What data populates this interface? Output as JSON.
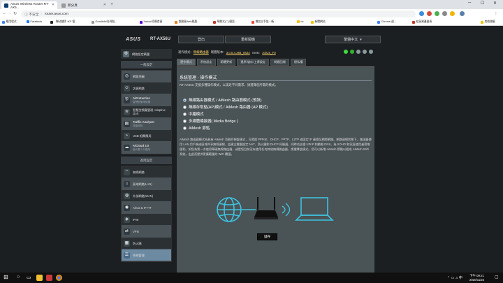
{
  "browser": {
    "tabs": [
      {
        "title": "ASUS Wireless Router RT-AX5...",
        "active": true
      },
      {
        "title": "新分頁",
        "active": false
      }
    ],
    "url_security": "不安全",
    "url": "router.asus.com",
    "bookmarks": [
      "應用程式",
      "Facebook",
      "【新遊戲】IKF 懷...",
      "Goodinfo!台灣股...",
      "Yahoo!奇摩首頁",
      "冒險島Web鳳凰...",
      "華鼎式(二)優惠...",
      "增加立手強・衛...",
      "bc",
      "新聞網站",
      "Chrome 週...",
      "松鼠資產量表",
      "其他書籤"
    ]
  },
  "router": {
    "brand": "ASUS",
    "model": "RT-AX56U",
    "top_buttons": [
      "登出",
      "重新開機"
    ],
    "language": "繁體中文",
    "info": {
      "mode_label": "運作模式:",
      "mode_value": "無線路由器",
      "firmware_label": "韌體版本:",
      "firmware_value": "3.0.0.4.384_9424",
      "ssid_label": "SSID:",
      "ssid_value": "ASUS_F0"
    },
    "sidebar": {
      "quick_setup": "網路設定精靈",
      "general_header": "一般設定",
      "general": [
        {
          "label": "網路地圖",
          "sub": ""
        },
        {
          "label": "訪客網路",
          "sub": ""
        },
        {
          "label": "AiProtection",
          "sub": "智慧型家用防護"
        },
        {
          "label": "智慧型頻寬管理 Adaptive QoS",
          "sub": ""
        },
        {
          "label": "Traffic Analyzer",
          "sub": "流量分析"
        },
        {
          "label": "USB 相關應用",
          "sub": ""
        },
        {
          "label": "AiCloud 2.0",
          "sub": "個人雲 2.0 應用"
        }
      ],
      "advanced_header": "進階設定",
      "advanced": [
        "無線網路",
        "區域網路(LAN)",
        "外部網路(WAN)",
        "Alexa & IFTTT",
        "IPv6",
        "VPN",
        "防火牆",
        "系統管理"
      ]
    },
    "subtabs": [
      "運作模式",
      "系統設定",
      "韌體更新",
      "還原/儲存/上傳設定",
      "問題回報",
      "隱私權"
    ],
    "content": {
      "title": "系統管理 - 操作模式",
      "description": "RT-AX56U 支援多種操作模式，以滿足不同需求，請選擇您所需的模式。",
      "options": [
        {
          "label": "無線路由器模式 / AiMesh 路由器模式 (預設)",
          "checked": true
        },
        {
          "label": "無線存取點(AP)模式 / AiMesh 路由器 (AP 模式)",
          "checked": false
        },
        {
          "label": "中繼模式",
          "checked": false
        },
        {
          "label": "多媒體橋接器( Media Bridge )",
          "checked": false
        },
        {
          "label": "AiMesh 節點",
          "checked": false
        }
      ],
      "paragraph": "AiMesh 路由器模式為具有 AiMesh 功能的預設模式，可透過 PPPoE、DHCP、PPTP、L2TP 或固定 IP 連線至網際網路。網路連線狀態下，路由器使用 LAN 用戶端或區域共享無線連線，並建立電腦設定 NAT、防火牆和 DHCP 伺服器，同時也支援 UPnP 和動態 DNS，為 SOHO 和家庭使用者帶來便利。如您為第一次使用華碩無線路由器，或是您目前沒有使用任何其他無線路由器，請選擇此模式。您可以新增 AiMesh 節點以組成 AiMesh WiFi 系統，由此而提供更廣範圍的 WiFi 覆蓋。",
      "apply_label": "儲存"
    }
  },
  "taskbar": {
    "time": "下午 09:21",
    "date": "2020/11/22"
  },
  "colors": {
    "page_bg": "#1c1f21",
    "content_bg": "#4a5356",
    "selected_item": "#6c8ba3",
    "highlight_value": "#ffd86b",
    "diagram": "#3fc4e0"
  }
}
